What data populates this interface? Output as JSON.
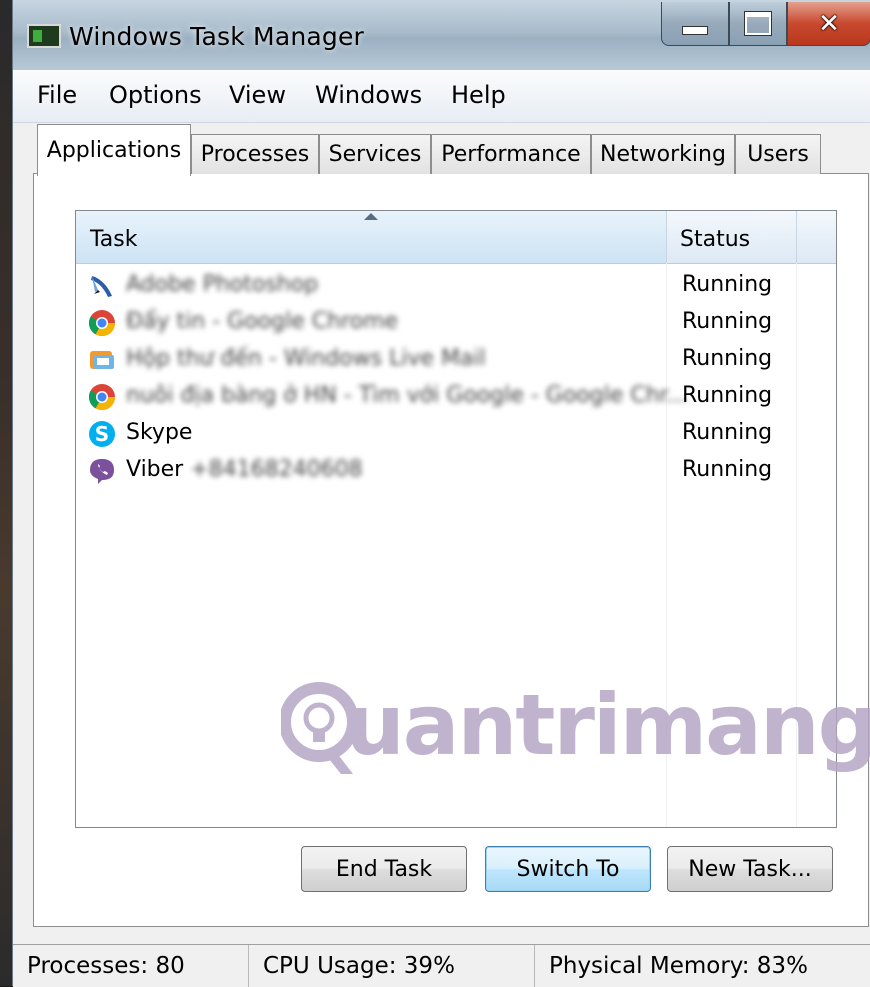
{
  "window": {
    "title": "Windows Task Manager"
  },
  "menu": [
    "File",
    "Options",
    "View",
    "Windows",
    "Help"
  ],
  "tabs": [
    "Applications",
    "Processes",
    "Services",
    "Performance",
    "Networking",
    "Users"
  ],
  "active_tab": "Applications",
  "list": {
    "columns": {
      "task": "Task",
      "status": "Status"
    },
    "rows": [
      {
        "name": "Adobe Photoshop",
        "status": "Running",
        "icon": "photoshop-feather-icon",
        "blurred": true
      },
      {
        "name": "Đẩy tin - Google Chrome",
        "status": "Running",
        "icon": "chrome-icon",
        "blurred": true
      },
      {
        "name": "Hộp thư đến - Windows Live Mail",
        "status": "Running",
        "icon": "mail-icon",
        "blurred": true
      },
      {
        "name": "nuôi địa bàng ở HN - Tìm với Google - Google Chr...",
        "status": "Running",
        "icon": "chrome-icon",
        "blurred": true
      },
      {
        "name": "Skype",
        "status": "Running",
        "icon": "skype-icon",
        "blurred": false
      },
      {
        "name": "Viber",
        "status": "Running",
        "icon": "viber-icon",
        "blurred": false,
        "suffix": "+84168240608"
      }
    ]
  },
  "watermark": "uantrimang",
  "buttons": {
    "end_task": "End Task",
    "switch_to": "Switch To",
    "new_task": "New Task..."
  },
  "status": {
    "processes": "Processes: 80",
    "cpu": "CPU Usage: 39%",
    "memory": "Physical Memory: 83%"
  },
  "colors": {
    "title_bar": "#a9bccb",
    "close_button": "#c8492f",
    "selection_header": "#cde3f4",
    "watermark": "#b6a6c6"
  }
}
